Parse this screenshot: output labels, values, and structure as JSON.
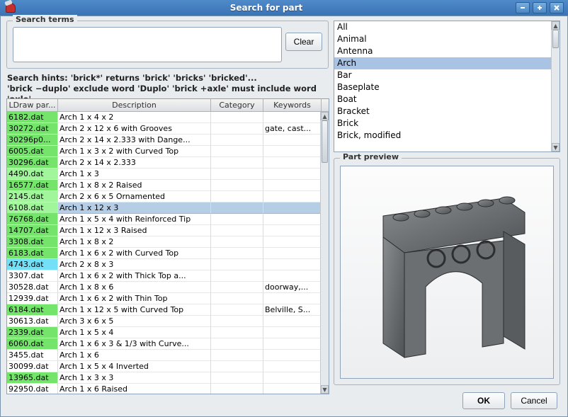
{
  "window": {
    "title": "Search for part",
    "minimize": "_",
    "maximize": "+",
    "close": "×"
  },
  "search": {
    "group_label": "Search terms",
    "value": "",
    "clear_label": "Clear"
  },
  "hints_line1": "Search hints: 'brick*' returns 'brick' 'bricks' 'bricked'...",
  "hints_line2": "'brick −duplo' exclude word 'Duplo' 'brick +axle' must include word 'axle'",
  "table": {
    "headers": [
      "LDraw par...",
      "Description",
      "Category",
      "Keywords"
    ],
    "selected_index": 8,
    "rows": [
      {
        "f": "6182.dat",
        "d": "Arch  1 x  4 x  2",
        "c": "",
        "k": "",
        "hl": "green"
      },
      {
        "f": "30272.dat",
        "d": "Arch  2 x 12 x  6 with Grooves",
        "c": "",
        "k": "gate, cast...",
        "hl": "green"
      },
      {
        "f": "30296p0...",
        "d": "Arch  2 x 14 x  2.333 with Dange...",
        "c": "",
        "k": "",
        "hl": "green"
      },
      {
        "f": "6005.dat",
        "d": "Arch  1 x  3 x  2 with Curved Top",
        "c": "",
        "k": "",
        "hl": "green"
      },
      {
        "f": "30296.dat",
        "d": "Arch  2 x 14 x  2.333",
        "c": "",
        "k": "",
        "hl": "green"
      },
      {
        "f": "4490.dat",
        "d": "Arch  1 x  3",
        "c": "",
        "k": "",
        "hl": "lightgreen"
      },
      {
        "f": "16577.dat",
        "d": "Arch  1 x  8 x  2 Raised",
        "c": "",
        "k": "",
        "hl": "green"
      },
      {
        "f": "2145.dat",
        "d": "Arch  2 x  6 x  5 Ornamented",
        "c": "",
        "k": "",
        "hl": "lightgreen"
      },
      {
        "f": "6108.dat",
        "d": "Arch  1 x 12 x  3",
        "c": "",
        "k": "",
        "hl": "lightgreen"
      },
      {
        "f": "76768.dat",
        "d": "Arch  1 x  5 x  4 with Reinforced Tip",
        "c": "",
        "k": "",
        "hl": "green"
      },
      {
        "f": "14707.dat",
        "d": "Arch  1 x 12 x  3 Raised",
        "c": "",
        "k": "",
        "hl": "green"
      },
      {
        "f": "3308.dat",
        "d": "Arch  1 x  8 x  2",
        "c": "",
        "k": "",
        "hl": "green"
      },
      {
        "f": "6183.dat",
        "d": "Arch  1 x  6 x  2 with Curved Top",
        "c": "",
        "k": "",
        "hl": "green"
      },
      {
        "f": "4743.dat",
        "d": "Arch  2 x  8 x  3",
        "c": "",
        "k": "",
        "hl": "cyan"
      },
      {
        "f": "3307.dat",
        "d": "Arch  1 x  6 x  2 with Thick Top a...",
        "c": "",
        "k": "",
        "hl": ""
      },
      {
        "f": "30528.dat",
        "d": "Arch  1 x  8 x  6",
        "c": "",
        "k": "doorway,...",
        "hl": ""
      },
      {
        "f": "12939.dat",
        "d": "Arch  1 x  6 x  2 with Thin Top",
        "c": "",
        "k": "",
        "hl": ""
      },
      {
        "f": "6184.dat",
        "d": "Arch  1 x 12 x  5 with Curved Top",
        "c": "",
        "k": "Belville, S...",
        "hl": "green"
      },
      {
        "f": "30613.dat",
        "d": "Arch  3 x  6 x  5",
        "c": "",
        "k": "",
        "hl": ""
      },
      {
        "f": "2339.dat",
        "d": "Arch  1 x  5 x  4",
        "c": "",
        "k": "",
        "hl": "green"
      },
      {
        "f": "6060.dat",
        "d": "Arch  1 x  6 x  3  & 1/3 with Curve...",
        "c": "",
        "k": "",
        "hl": "green"
      },
      {
        "f": "3455.dat",
        "d": "Arch  1 x  6",
        "c": "",
        "k": "",
        "hl": ""
      },
      {
        "f": "30099.dat",
        "d": "Arch  1 x  5 x  4 Inverted",
        "c": "",
        "k": "",
        "hl": ""
      },
      {
        "f": "13965.dat",
        "d": "Arch  1 x  3 x  3",
        "c": "",
        "k": "",
        "hl": "green"
      },
      {
        "f": "92950.dat",
        "d": "Arch  1 x  6 Raised",
        "c": "",
        "k": "",
        "hl": ""
      }
    ]
  },
  "categories": {
    "selected_index": 3,
    "items": [
      "All",
      "Animal",
      "Antenna",
      "Arch",
      "Bar",
      "Baseplate",
      "Boat",
      "Bracket",
      "Brick",
      "Brick, modified"
    ]
  },
  "preview": {
    "group_label": "Part preview"
  },
  "buttons": {
    "ok": "OK",
    "cancel": "Cancel"
  }
}
